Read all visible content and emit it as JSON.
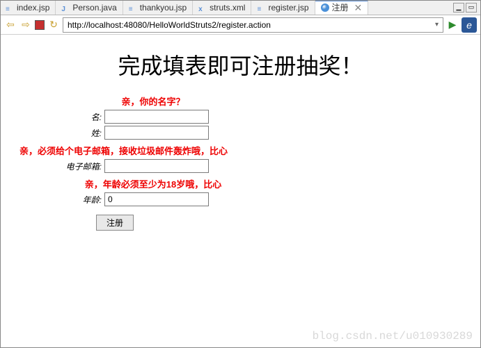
{
  "tabs": [
    {
      "label": "index.jsp",
      "icon": "jsp"
    },
    {
      "label": "Person.java",
      "icon": "java"
    },
    {
      "label": "thankyou.jsp",
      "icon": "jsp"
    },
    {
      "label": "struts.xml",
      "icon": "xml"
    },
    {
      "label": "register.jsp",
      "icon": "jsp"
    },
    {
      "label": "注册",
      "icon": "globe",
      "active": true
    }
  ],
  "url": "http://localhost:48080/HelloWorldStruts2/register.action",
  "page": {
    "title": "完成填表即可注册抽奖！"
  },
  "form": {
    "error_name": "亲，你的名字？",
    "label_firstname": "名:",
    "value_firstname": "",
    "label_lastname": "姓:",
    "value_lastname": "",
    "error_email": "亲，必须给个电子邮箱，接收垃圾邮件轰炸哦，比心",
    "label_email": "电子邮箱:",
    "value_email": "",
    "error_age": "亲，年龄必须至少为18岁哦，比心",
    "label_age": "年龄:",
    "value_age": "0",
    "submit_label": "注册"
  },
  "watermark": "blog.csdn.net/u010930289"
}
